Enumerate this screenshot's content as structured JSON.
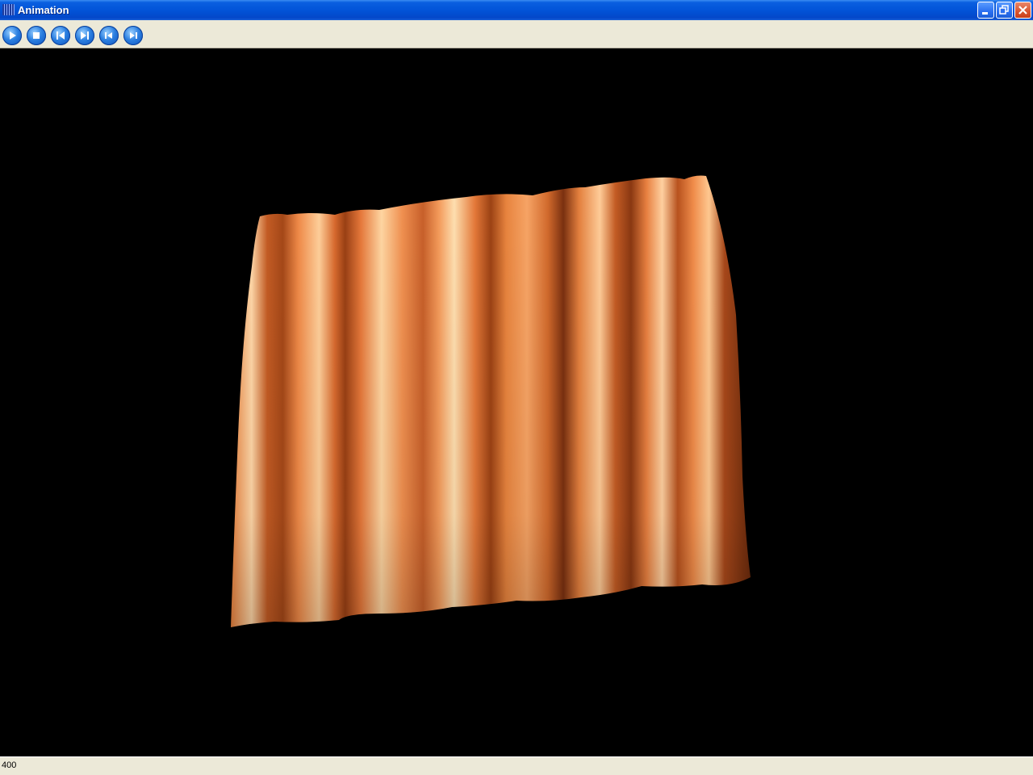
{
  "window": {
    "title": "Animation",
    "icon": "app-grid-icon",
    "controls": [
      "minimize-icon",
      "restore-icon",
      "close-icon"
    ]
  },
  "toolbar": {
    "buttons": [
      {
        "name": "play-button",
        "icon": "play-icon"
      },
      {
        "name": "stop-button",
        "icon": "stop-icon"
      },
      {
        "name": "first-frame-button",
        "icon": "skip-to-start-icon"
      },
      {
        "name": "last-frame-button",
        "icon": "skip-to-end-icon"
      },
      {
        "name": "step-back-button",
        "icon": "step-back-icon"
      },
      {
        "name": "step-forward-button",
        "icon": "step-forward-icon"
      }
    ]
  },
  "viewport": {
    "background": "#000000",
    "cloth_color": "#e07038",
    "highlight_color": "#ffd0a0",
    "shadow_color": "#8a3a12"
  },
  "status": {
    "frame": "400"
  }
}
